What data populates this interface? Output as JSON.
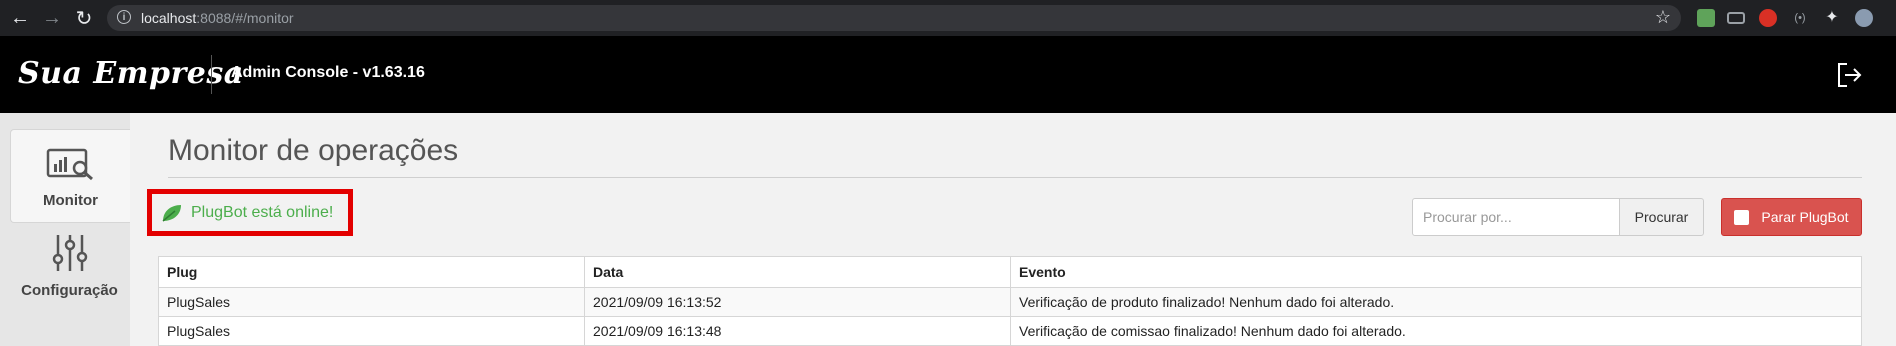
{
  "browser": {
    "url_host": "localhost",
    "url_rest": ":8088/#/monitor"
  },
  "header": {
    "logo": "Sua Empresa",
    "title": "Admin Console - v1.63.16"
  },
  "sidebar": {
    "items": [
      {
        "label": "Monitor",
        "icon": "monitor-chart-icon",
        "active": true
      },
      {
        "label": "Configuração",
        "icon": "sliders-icon",
        "active": false
      }
    ]
  },
  "main": {
    "title": "Monitor de operações",
    "status": "PlugBot está online!",
    "search_placeholder": "Procurar por...",
    "search_button": "Procurar",
    "stop_button": "Parar PlugBot"
  },
  "table": {
    "columns": [
      "Plug",
      "Data",
      "Evento"
    ],
    "rows": [
      [
        "PlugSales",
        "2021/09/09 16:13:52",
        "Verificação de produto finalizado! Nenhum dado foi alterado."
      ],
      [
        "PlugSales",
        "2021/09/09 16:13:48",
        "Verificação de comissao finalizado! Nenhum dado foi alterado."
      ]
    ]
  },
  "colors": {
    "status_green": "#4cae4c",
    "stop_red": "#d9534f",
    "highlight_red": "#e30000"
  }
}
